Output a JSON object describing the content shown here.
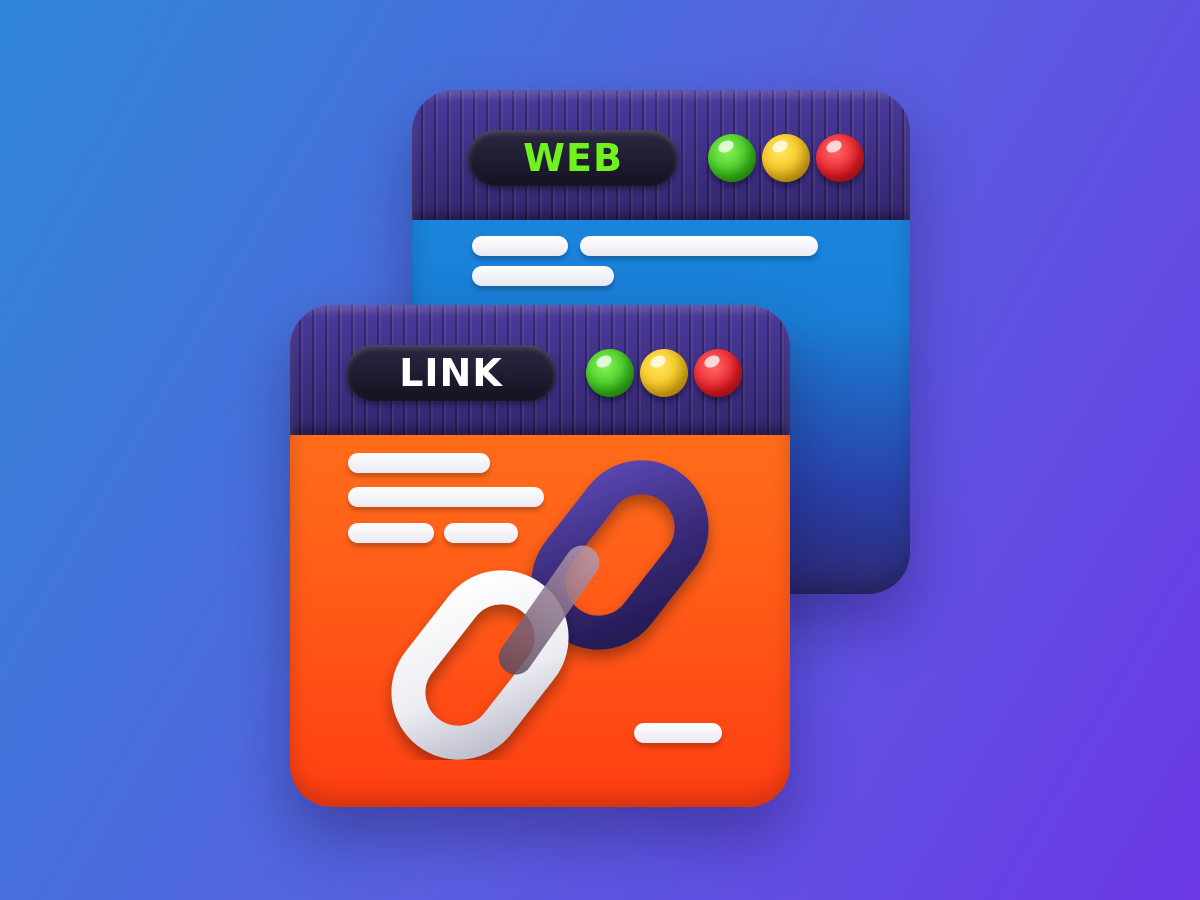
{
  "windows": {
    "web": {
      "title": "WEB",
      "title_color": "#6ff21e",
      "body_color": "#1a8ae2"
    },
    "link": {
      "title": "LINK",
      "title_color": "#ffffff",
      "body_color": "#ff5d18"
    }
  },
  "traffic_lights": [
    "green",
    "yellow",
    "red"
  ],
  "colors": {
    "titlebar": "#3a2c80",
    "background_start": "#2f86d8",
    "background_end": "#6b38e6",
    "chain_dark": "#3a2a7a",
    "chain_light": "#f2f2f5"
  },
  "icons": [
    "chain-link-icon"
  ]
}
